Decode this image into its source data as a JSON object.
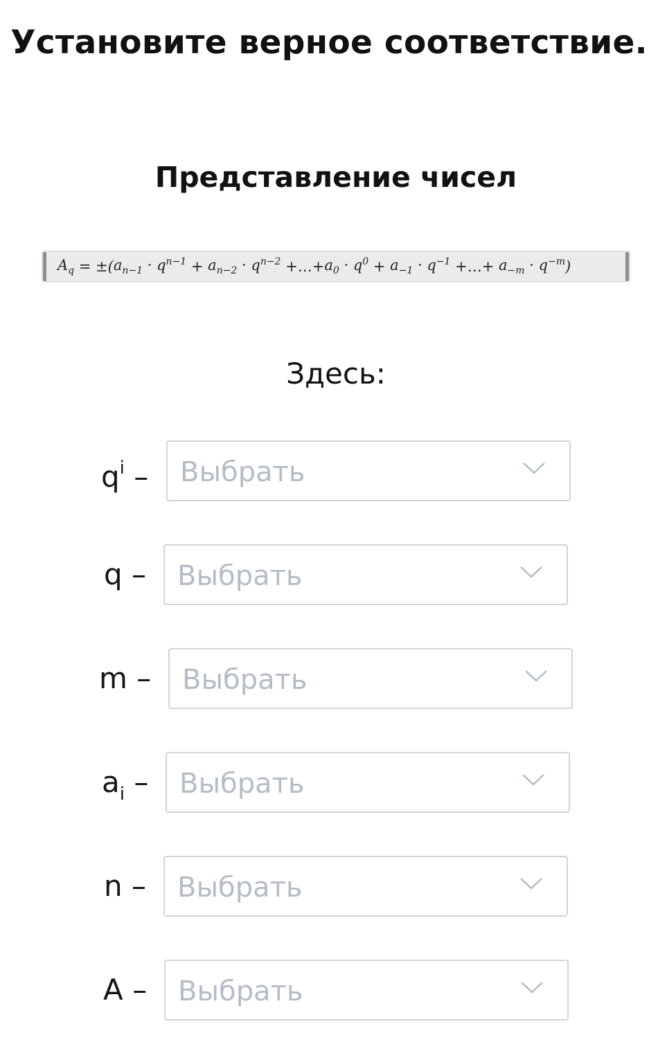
{
  "title": "Установите верное соответствие.",
  "subtitle": "Представление чисел",
  "formula": {
    "lhs_base": "A",
    "lhs_sub": "q",
    "eq": " = ±(",
    "t1_base": "a",
    "t1_sub": "n−1",
    "t1_mid": " · q",
    "t1_sup": "n−1",
    "plus1": " + ",
    "t2_base": "a",
    "t2_sub": "n−2",
    "t2_mid": " · q",
    "t2_sup": "n−2",
    "dots1": " +…+",
    "t3_base": "a",
    "t3_sub": "0",
    "t3_mid": " · q",
    "t3_sup": "0",
    "plus2": " + ",
    "t4_base": "a",
    "t4_sub": "−1",
    "t4_mid": " · q",
    "t4_sup": "−1",
    "dots2": " +…+ ",
    "t5_base": "a",
    "t5_sub": "−m",
    "t5_mid": " · q",
    "t5_sup": "−m",
    "close": ")"
  },
  "here_label": "Здесь:",
  "rows": [
    {
      "label_base": "q",
      "label_sup": "i",
      "label_sub": "",
      "dash": " –",
      "placeholder": "Выбрать"
    },
    {
      "label_base": "q",
      "label_sup": "",
      "label_sub": "",
      "dash": " –",
      "placeholder": "Выбрать"
    },
    {
      "label_base": "m",
      "label_sup": "",
      "label_sub": "",
      "dash": " –",
      "placeholder": "Выбрать"
    },
    {
      "label_base": "a",
      "label_sup": "",
      "label_sub": "i",
      "dash": " –",
      "placeholder": "Выбрать"
    },
    {
      "label_base": "n",
      "label_sup": "",
      "label_sub": "",
      "dash": " –",
      "placeholder": "Выбрать"
    },
    {
      "label_base": "A",
      "label_sup": "",
      "label_sub": "",
      "dash": " –",
      "placeholder": "Выбрать"
    }
  ],
  "icons": {
    "dropdown": "chevron-down-icon"
  },
  "colors": {
    "placeholder": "#b5bcc6",
    "border": "#d4d4d4",
    "chevron": "#b5bcc6"
  }
}
